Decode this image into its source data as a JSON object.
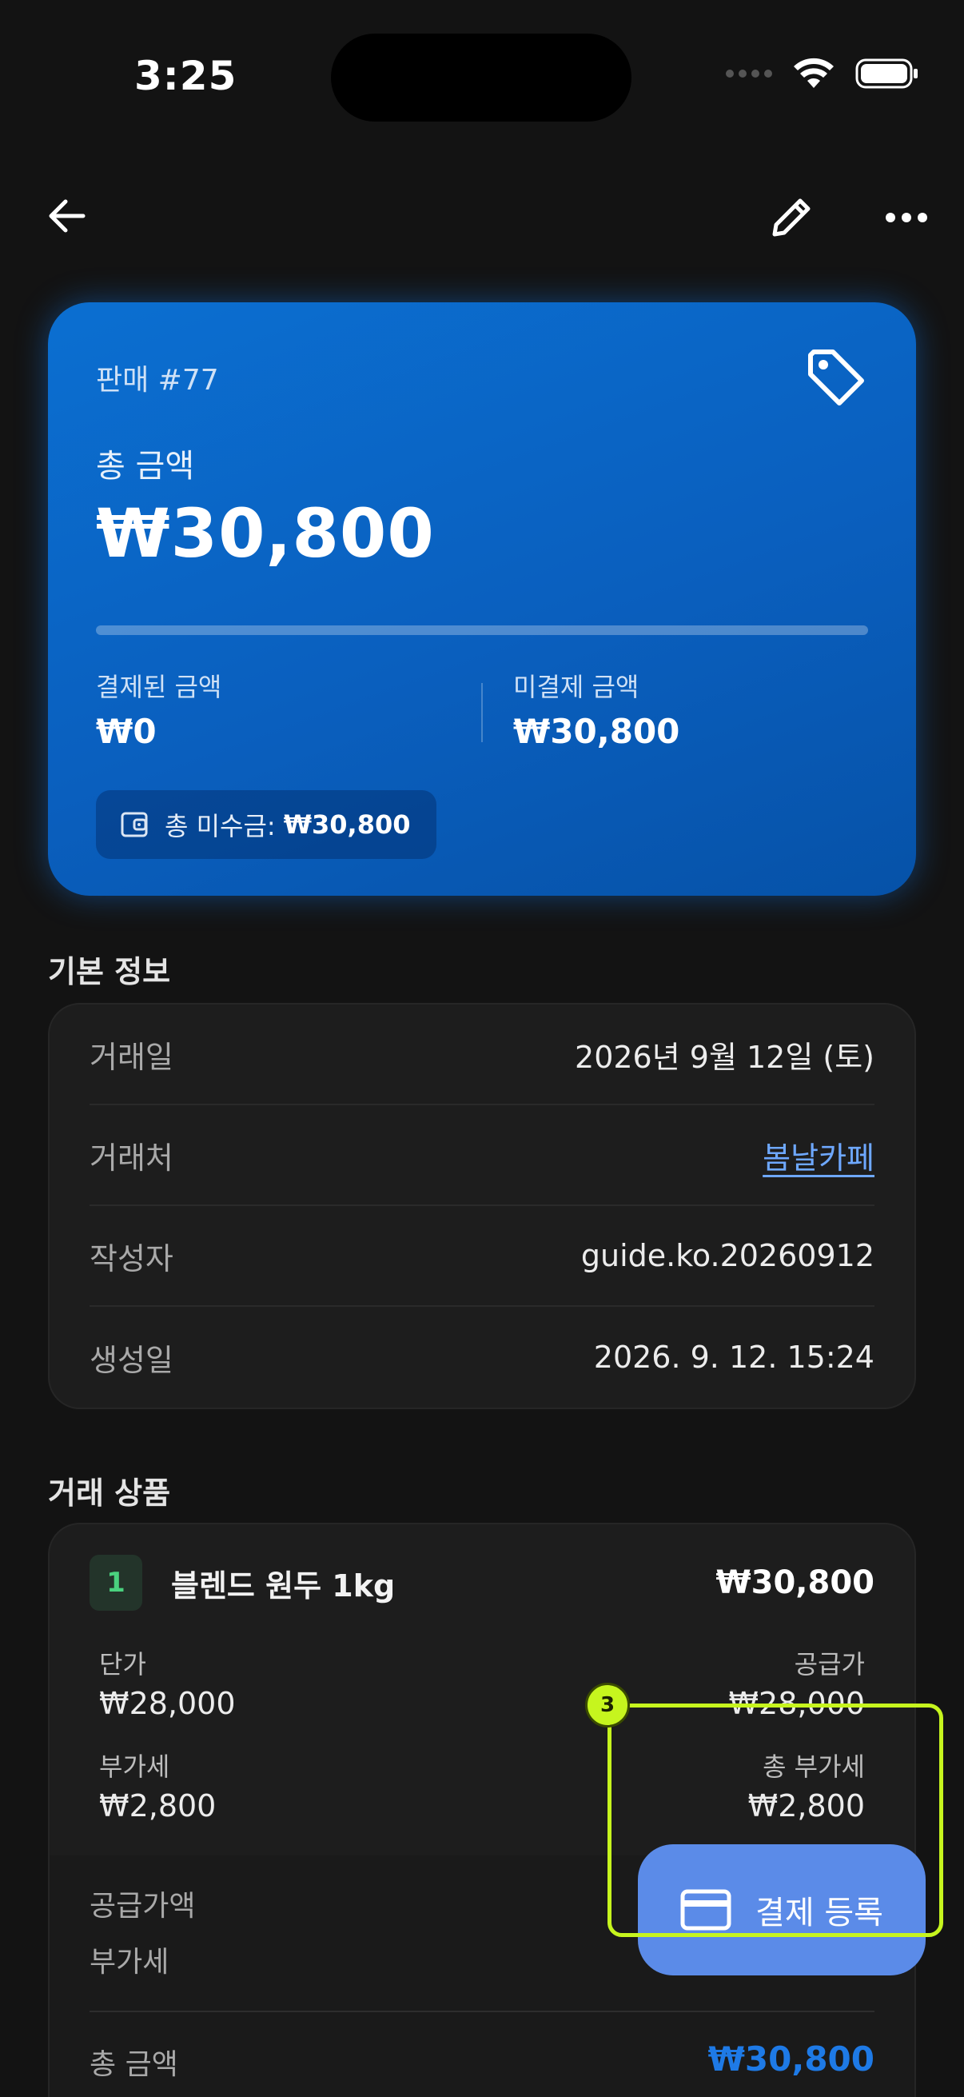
{
  "status": {
    "time": "3:25"
  },
  "hero": {
    "subtitle": "판매 #77",
    "total_label": "총 금액",
    "total_amount": "₩30,800",
    "paid_fraction": 0,
    "paid_label": "결제된 금액",
    "paid_value": "₩0",
    "unpaid_label": "미결제 금액",
    "unpaid_value": "₩30,800",
    "outstanding_label": "총 미수금:",
    "outstanding_value": "₩30,800"
  },
  "basic_info": {
    "title": "기본 정보",
    "rows": [
      {
        "label": "거래일",
        "value": "2026년 9월 12일 (토)"
      },
      {
        "label": "거래처",
        "value": "봄날카페"
      },
      {
        "label": "작성자",
        "value": "guide.ko.20260912"
      },
      {
        "label": "생성일",
        "value": "2026. 9. 12. 15:24"
      }
    ]
  },
  "products": {
    "title": "거래 상품",
    "items": [
      {
        "index": "1",
        "name": "블렌드 원두 1kg",
        "total": "₩30,800",
        "unit_price_label": "단가",
        "unit_price": "₩28,000",
        "supply_label": "공급가",
        "supply": "₩28,000",
        "vat_label": "부가세",
        "vat": "₩2,800",
        "total_vat_label": "총 부가세",
        "total_vat": "₩2,800"
      }
    ],
    "summary": {
      "supply_label": "공급가액",
      "vat_label": "부가세",
      "total_label": "총 금액",
      "total_value": "₩30,800"
    }
  },
  "fab": {
    "label": "결제 등록"
  },
  "overlay": {
    "step": "3",
    "accent": "#c6f51e"
  },
  "colors": {
    "background": "#131313",
    "card_blue": "#0a5fbe",
    "link": "#6ea8ff",
    "total_blue": "#1e7ae6",
    "fab": "#5b8be8"
  }
}
